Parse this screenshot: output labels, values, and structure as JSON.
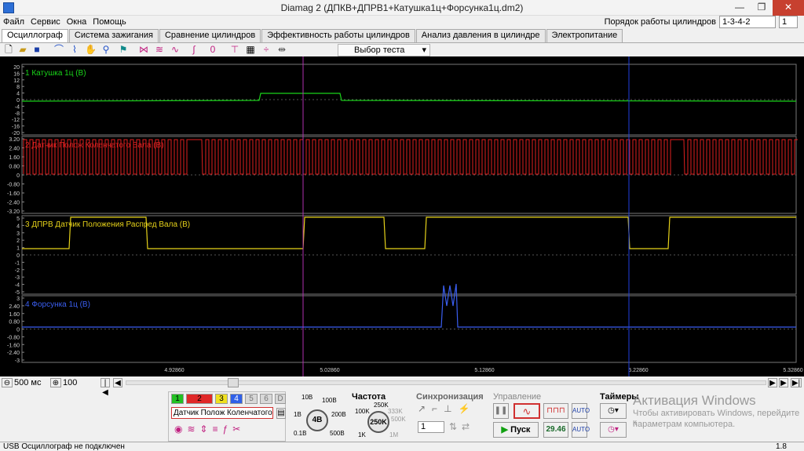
{
  "window": {
    "title": "Diamag 2 (ДПКВ+ДПРВ1+Катушка1ц+Форсунка1ц.dm2)",
    "min": "—",
    "max": "❐",
    "close": "✕"
  },
  "menu": [
    "Файл",
    "Сервис",
    "Окна",
    "Помощь"
  ],
  "cylinder_order": {
    "label": "Порядок работы цилиндров",
    "value": "1-3-4-2",
    "count": "1"
  },
  "tabs": [
    "Осциллограф",
    "Система зажигания",
    "Сравнение цилиндров",
    "Эффективность работы цилиндров",
    "Анализ давления в цилиндре",
    "Электропитание"
  ],
  "toolbar": {
    "test_select": "Выбор теста"
  },
  "channels": [
    {
      "name": "1 Катушка 1ц (В)",
      "color": "#19d419",
      "ticks": [
        "20",
        "16",
        "12",
        "8",
        "4",
        "0",
        "-4",
        "-8",
        "-12",
        "-16",
        "-20"
      ]
    },
    {
      "name": "2 Датчик Полож Коленчатого Вала (В)",
      "color": "#e02020",
      "ticks": [
        "3.20",
        "2.40",
        "1.60",
        "0.80",
        "0",
        "-0.80",
        "-1.60",
        "-2.40",
        "-3.20"
      ]
    },
    {
      "name": "3 ДПРВ Датчик Положения Распред Вала (В)",
      "color": "#e6d21a",
      "ticks": [
        "5",
        "4",
        "3",
        "2",
        "1",
        "0",
        "-1",
        "-2",
        "-3",
        "-4",
        "-5"
      ]
    },
    {
      "name": "4 Форсунка 1ц (В)",
      "color": "#3a5ef0",
      "ticks": [
        "3",
        "2.40",
        "1.60",
        "0.80",
        "0",
        "-0.80",
        "-1.60",
        "-2.40",
        "-3"
      ]
    }
  ],
  "time_axis": [
    "4.92860",
    "5.02860",
    "5.12860",
    "5.22860",
    "5.32860"
  ],
  "bottom_bar": {
    "time_div": "500 мс",
    "amp": "100"
  },
  "channel_buttons": [
    "1",
    "2",
    "3",
    "4",
    "5",
    "6",
    "D"
  ],
  "channel_select": "Датчик Полож Коленчатого Ва",
  "volt_dial": {
    "labels": [
      "10B",
      "100B",
      "1B",
      "200B",
      "0.1B",
      "500B"
    ],
    "value": "4B"
  },
  "freq": {
    "title": "Частота",
    "labels": [
      "250K",
      "100K",
      "333K",
      "500K",
      "1K",
      "1M"
    ],
    "value": "250K"
  },
  "sync": {
    "title": "Синхронизация",
    "value": "1"
  },
  "control": {
    "title": "Управление",
    "start": "Пуск",
    "value": "29.46"
  },
  "timers": {
    "title": "Таймеры"
  },
  "activation": {
    "line1": "Активация Windows",
    "line2": "Чтобы активировать Windows, перейдите к",
    "line3": "параметрам компьютера."
  },
  "status": {
    "left": "USB Осциллограф не подключен",
    "right": "1.8"
  }
}
